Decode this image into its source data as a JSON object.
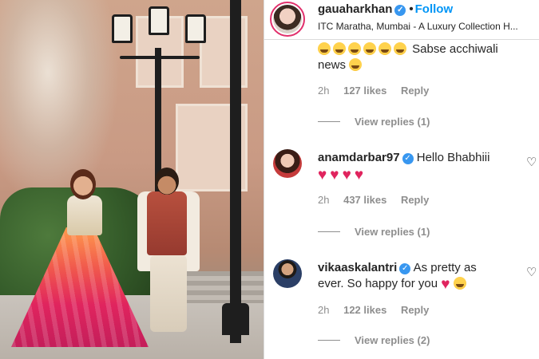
{
  "header": {
    "username": "gauaharkhan",
    "separator": "•",
    "follow_label": "Follow",
    "location": "ITC Maratha, Mumbai - A Luxury Collection H..."
  },
  "comments": [
    {
      "username": "",
      "text": "Sabse acchiwali news",
      "time": "2h",
      "likes": "127 likes",
      "reply_label": "Reply",
      "view_replies": "View replies (1)"
    },
    {
      "username": "anamdarbar97",
      "text": "Hello Bhabhiii",
      "time": "2h",
      "likes": "437 likes",
      "reply_label": "Reply",
      "view_replies": "View replies (1)"
    },
    {
      "username": "vikaaskalantri",
      "text_line1": "As pretty as",
      "text_line2": "ever. So happy for you",
      "time": "2h",
      "likes": "122 likes",
      "reply_label": "Reply",
      "view_replies": "View replies (2)"
    }
  ],
  "colors": {
    "follow": "#0095f6",
    "verified": "#3897f0",
    "heart": "#e0245e",
    "meta": "#8e8e8e"
  },
  "icons": [
    "verified-badge-icon",
    "heart-outline-icon",
    "red-heart-emoji",
    "smiling-face-emoji"
  ]
}
